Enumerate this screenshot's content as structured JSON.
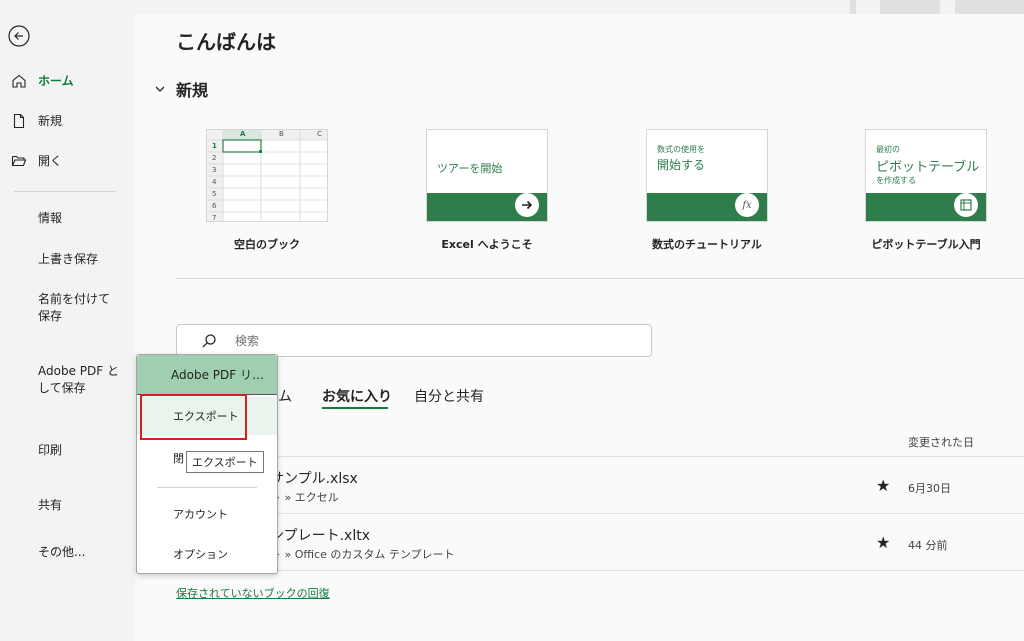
{
  "nav": {
    "items": [
      {
        "label": "ホーム",
        "icon": "home-icon"
      },
      {
        "label": "新規",
        "icon": "new-document-icon"
      },
      {
        "label": "開く",
        "icon": "folder-open-icon"
      },
      {
        "label": "情報"
      },
      {
        "label": "上書き保存"
      },
      {
        "label": "名前を付けて\n保存"
      },
      {
        "label": "Adobe PDF と\nして保存"
      },
      {
        "label": "印刷"
      },
      {
        "label": "共有"
      },
      {
        "label": "その他..."
      }
    ]
  },
  "main": {
    "greeting": "こんばんは",
    "new_section": "新規",
    "tiles": [
      {
        "label": "空白のブック"
      },
      {
        "label": "Excel へようこそ",
        "title": "ツアーを開始"
      },
      {
        "label": "数式のチュートリアル",
        "small": "数式の使用を",
        "big": "開始する",
        "glyph": "fx"
      },
      {
        "label": "ピボットテーブル入門",
        "small": "最初の",
        "big": "ピボットテーブル",
        "small2": "を作成する"
      }
    ],
    "grid": {
      "cols": [
        "A",
        "B",
        "C"
      ],
      "rows": [
        "1",
        "2",
        "3",
        "4",
        "5",
        "6",
        "7"
      ]
    },
    "search_placeholder": "検索",
    "tabs": [
      "ム",
      "お気に入り",
      "自分と共有"
    ],
    "column_header": "変更された日",
    "files": [
      {
        "name": "サンプル.xlsx",
        "path": "ト » エクセル",
        "date": "6月30日"
      },
      {
        "name": "ンプレート.xltx",
        "path": "ト » Office のカスタム テンプレート",
        "date": "44 分前"
      }
    ],
    "recover_link": "保存されていないブックの回復"
  },
  "popup": {
    "header": "Adobe PDF リ…",
    "items": [
      "エクスポート",
      "閉",
      "アカウント",
      "オプション"
    ],
    "tooltip": "エクスポート"
  },
  "colors": {
    "accent": "#107c41",
    "tile_band": "#2e7d4a",
    "highlight_box": "#d42020"
  }
}
